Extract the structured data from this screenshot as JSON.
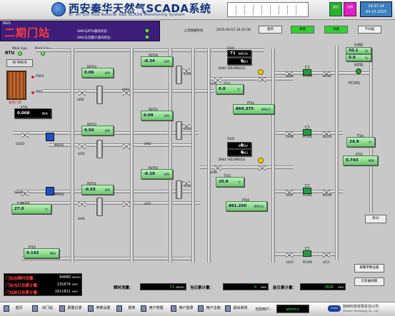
{
  "header": {
    "title_cn": "西安秦华天然气SCADA系统",
    "title_en": "Xi' an Qin Hua Natural Gas SCADA Monitoring System",
    "exit_label": "退出",
    "logout_label": "注销",
    "time": "18:37:14",
    "date": "04-15-2015"
  },
  "station": {
    "ngs": "NGS",
    "name": "二期门站",
    "uno_rtu_status": "UNO与RTU通讯状态：",
    "uno_meter_status": "UNO与流量计通讯状态："
  },
  "toolbar": {
    "last_update_label": "上次接报时间",
    "last_update_value": "2015-04-15 10:33:38",
    "trend": "趋势",
    "local": "本地",
    "scan": "扫描",
    "bypass": "不扫描"
  },
  "rtu": {
    "label": "RTU",
    "main_cpu": "Main Cpu",
    "back_cpu": "Back Cpu",
    "io_rack": "IO RACK",
    "pi01": "PO01",
    "pi02": "PO23",
    "cabinet_label": "备用门限"
  },
  "readouts": {
    "pt03": {
      "tag": "PDT03",
      "value": "0.06",
      "unit": "kPA"
    },
    "pt06": {
      "tag": "PDT06",
      "value": "-0.34",
      "unit": "kPA"
    },
    "pt01": {
      "tag": "PT01",
      "value": "0.008",
      "unit": "MPA"
    },
    "pt02": {
      "tag": "PDT02",
      "value": "0.50",
      "unit": "kPA"
    },
    "pt05": {
      "tag": "PDT05",
      "value": "0.09",
      "unit": "kPA"
    },
    "pt01b": {
      "tag": "PDT01",
      "value": "-0.63",
      "unit": "kPA"
    },
    "pt04": {
      "tag": "PDT04",
      "value": "-0.19",
      "unit": "kPA"
    },
    "tt01": {
      "tag": "TT01",
      "value": "27.0",
      "unit": "℃"
    },
    "pt02b": {
      "tag": "PT02",
      "value": "0.142",
      "unit": "MPA"
    },
    "tt02": {
      "tag": "TT02",
      "value": "0.0",
      "unit": "℃"
    },
    "pt03b": {
      "tag": "PT03",
      "value": "864.375",
      "unit": "KPA(A)"
    },
    "tt03": {
      "tag": "TT03",
      "value": "25.9",
      "unit": "℃"
    },
    "pt04b": {
      "tag": "PT04",
      "value": "861.250",
      "unit": "KPA(A)"
    },
    "tt04": {
      "tag": "TT04",
      "value": "24.9",
      "unit": "℃"
    },
    "pt05b": {
      "tag": "PT05",
      "value": "0.743",
      "unit": "MPA"
    }
  },
  "flowmeters": {
    "fq01": {
      "tag": "FQ01",
      "flow": "71",
      "flow_unit": "NM3/H",
      "total": "0",
      "total_unit": "NM3",
      "daily": "DAILY VOLUME(03)"
    },
    "fq02": {
      "tag": "FQ02",
      "flow": "0",
      "flow_unit": "NM3/H",
      "total": "0",
      "total_unit": "NM3",
      "daily": "DAILY VOLUME(02)"
    }
  },
  "odorant": {
    "label1": "反馈值",
    "value1": "50.1",
    "unit1": "%",
    "value2": "0.0",
    "unit2": "%",
    "label2": "给定值",
    "fcv": "FCV01"
  },
  "tags": {
    "lv03": "LV03",
    "lv06": "LV06",
    "lv14": "LV14",
    "lv02": "LV02",
    "lv13": "LV13",
    "lv05": "LV05",
    "lv01": "LV01",
    "lv12": "LV12",
    "lv08": "LV08",
    "lv04": "LV04",
    "lv202": "LV202",
    "lv203": "LV203",
    "lv204": "LV204",
    "lv201": "LV201",
    "lv09": "LV09",
    "pcv03": "PCV03",
    "lv221": "LV221",
    "lv08b": "LV08",
    "pcv02": "PCV02",
    "lv220": "LV220",
    "lv07": "LV07",
    "pcv01": "PCV01",
    "lv219": "LV219",
    "lv10": "LV10",
    "lv11": "LV11",
    "lv18": "LV18",
    "mrv01": "MRV01",
    "mrv02": "MRV02",
    "lv222": "LV222",
    "lv05b": "LV05",
    "pcv04": "PCV04",
    "lv214": "LV214"
  },
  "side_buttons": {
    "param_settings": "报警参数设置",
    "history_curve": "历史曲线图",
    "bypass_ctrl": "旁02"
  },
  "totals": {
    "instant_label": "门站总瞬时流量：",
    "instant_value": "94680",
    "instant_unit": "NM3/H",
    "today_label": "门站当日总累计量：",
    "today_value": "231674",
    "today_unit": "NM3",
    "yesterday_label": "门站前日总累计量：",
    "yesterday_value": "1611811",
    "yesterday_unit": "NM3"
  },
  "bottom_flow": {
    "instant_label": "瞬时流量：",
    "instant_value": "71",
    "instant_unit": "NM3/H",
    "today_label": "当日累计量：",
    "today_value": "0",
    "today_unit": "NM3",
    "prev_label": "前日累计量：",
    "prev_value": "2626",
    "prev_unit": "NM3"
  },
  "footer": {
    "nav": [
      "首页",
      "出门站",
      "报警记录",
      "参数设置",
      "报表",
      "用户管理",
      "用户登录",
      "用户注销",
      "退出系统"
    ],
    "user_label": "当前用户：",
    "user_value": "admin1",
    "company_cn": "陕西科技有限责任公司",
    "company_en": "Shaanxi Technology Co., Ltd.",
    "company_logo": "Yunex"
  },
  "colors": {
    "station_bar": "#3c1e7a",
    "station_name": "#ff3b3b",
    "readout_green": "#6ac86a",
    "button_green": "#30d030",
    "alarm_red": "#ff4040"
  }
}
